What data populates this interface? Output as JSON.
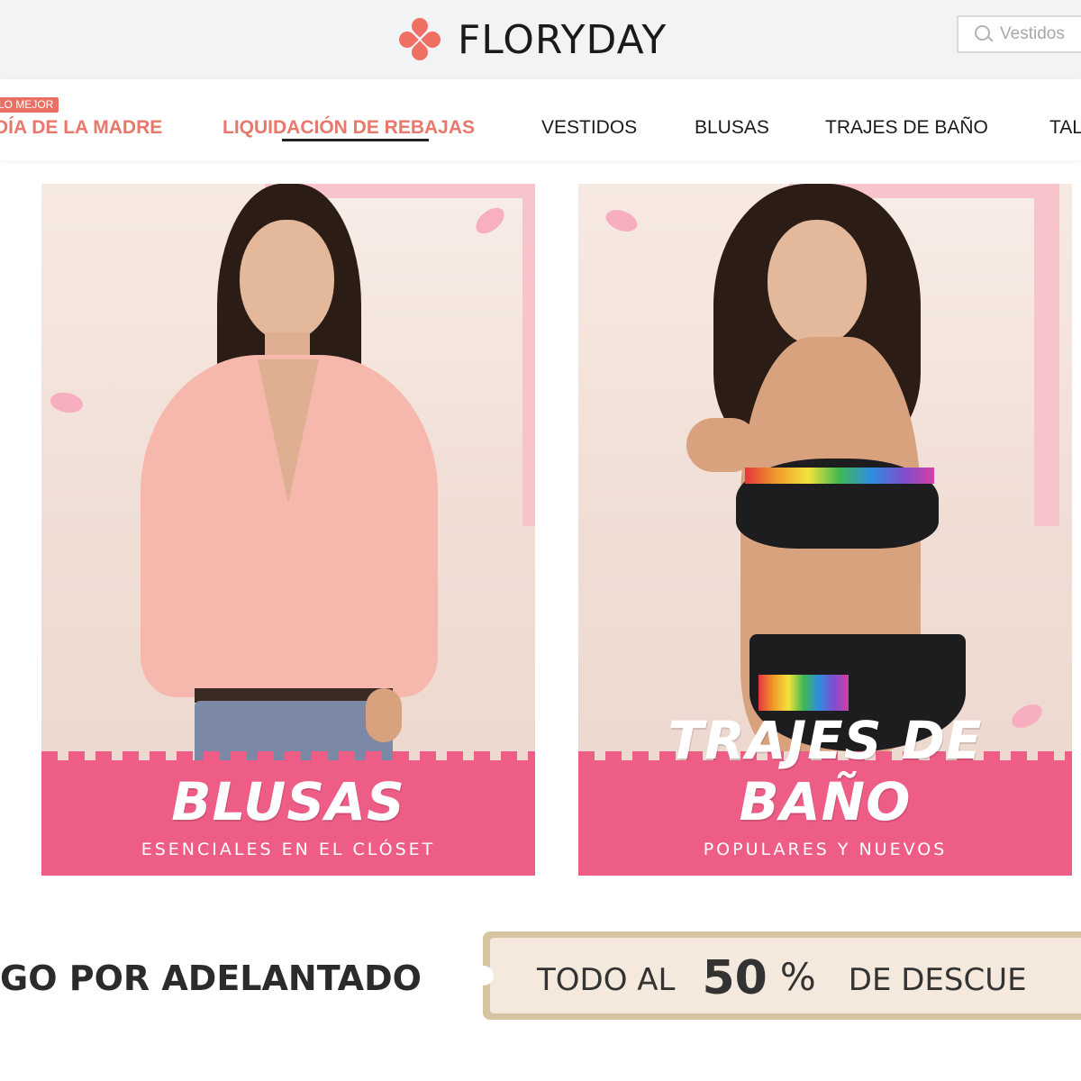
{
  "header": {
    "brand": "FLORYDAY",
    "search_placeholder": "Vestidos"
  },
  "nav": {
    "badge": "LO MEJOR",
    "items": [
      {
        "label": "DÍA DE LA MADRE",
        "color": "#e8786b"
      },
      {
        "label": "LIQUIDACIÓN DE REBAJAS",
        "color": "#e8786b",
        "active": true
      },
      {
        "label": "VESTIDOS"
      },
      {
        "label": "BLUSAS"
      },
      {
        "label": "TRAJES DE BAÑO"
      },
      {
        "label": "TAL"
      }
    ]
  },
  "banners": [
    {
      "title": "BLUSAS",
      "subtitle": "ESENCIALES EN EL CLÓSET"
    },
    {
      "title": "TRAJES DE BAÑO",
      "subtitle": "POPULARES Y NUEVOS"
    }
  ],
  "promo": {
    "left_text": "GO POR ADELANTADO",
    "ticket_prefix": "TODO AL",
    "ticket_number": "50",
    "ticket_percent": "%",
    "ticket_suffix": "DE DESCUE"
  },
  "colors": {
    "accent": "#e8786b",
    "banner_pink": "#ee5d86",
    "frame_pink": "#f7c4cc"
  }
}
